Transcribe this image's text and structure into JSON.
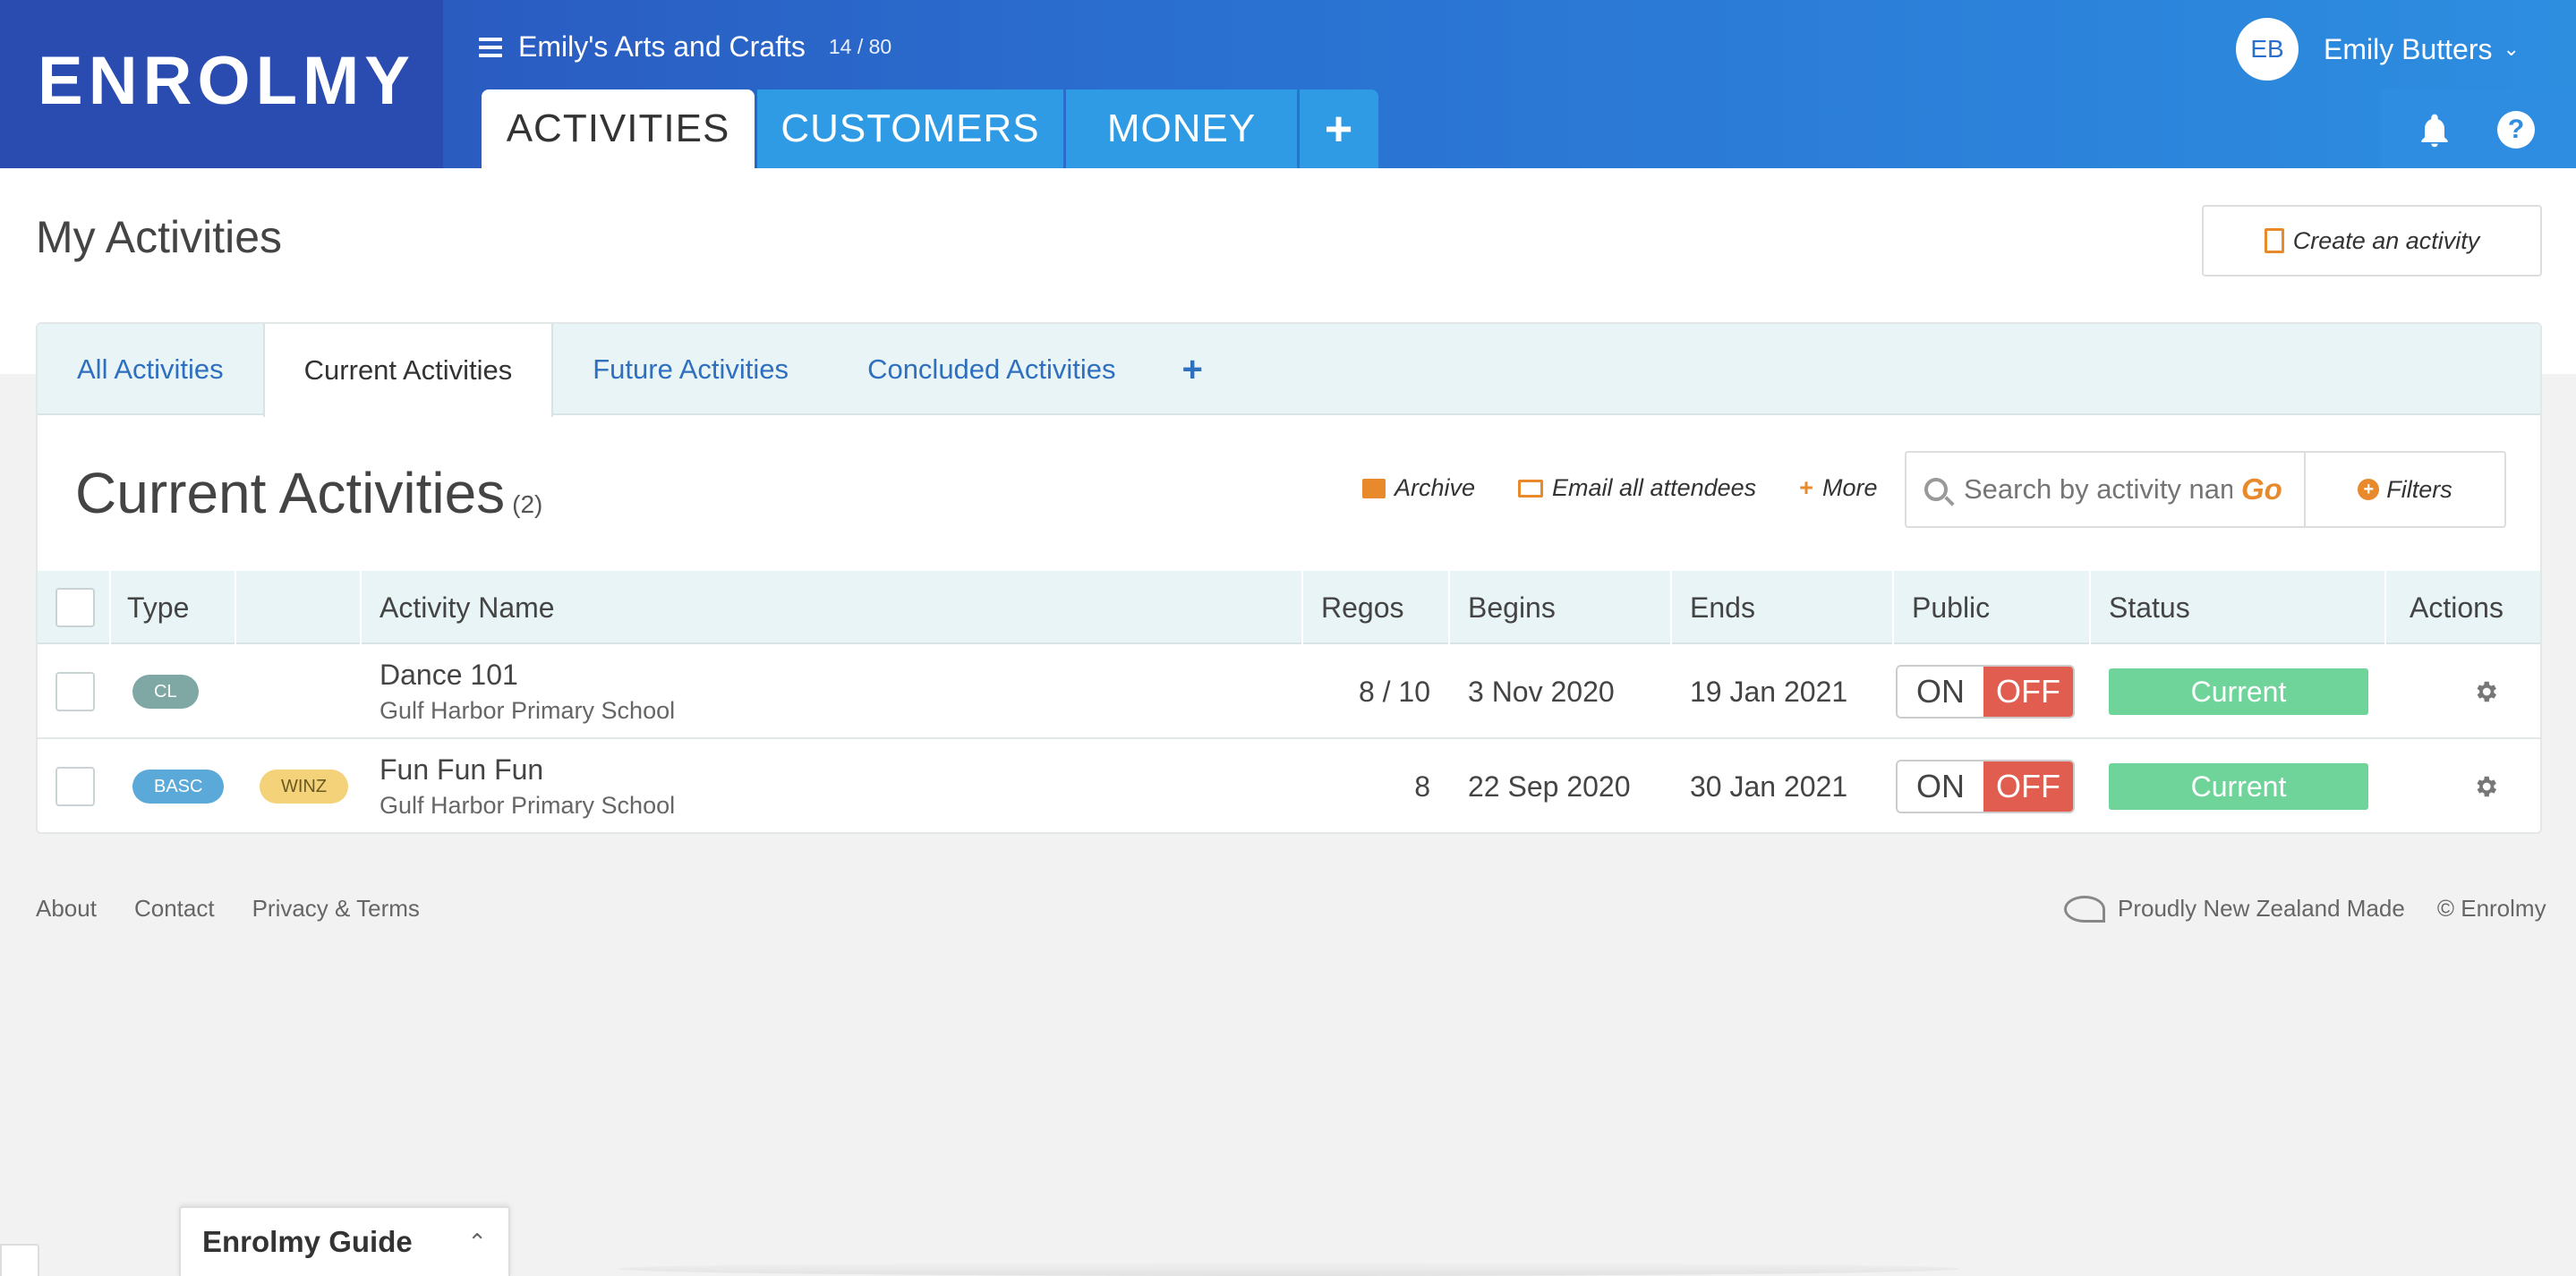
{
  "header": {
    "logo": "ENROLMY",
    "org_name": "Emily's Arts and Crafts",
    "org_count": "14 / 80",
    "nav_tabs": [
      {
        "label": "ACTIVITIES",
        "active": true
      },
      {
        "label": "CUSTOMERS",
        "active": false
      },
      {
        "label": "MONEY",
        "active": false
      }
    ],
    "nav_add": "+",
    "user_initials": "EB",
    "user_name": "Emily Butters",
    "help_glyph": "?"
  },
  "page": {
    "title": "My Activities",
    "create_button": "Create an activity"
  },
  "subtabs": [
    {
      "label": "All Activities",
      "active": false
    },
    {
      "label": "Current Activities",
      "active": true
    },
    {
      "label": "Future Activities",
      "active": false
    },
    {
      "label": "Concluded Activities",
      "active": false
    }
  ],
  "subtab_add": "+",
  "section": {
    "title": "Current Activities",
    "count": "(2)"
  },
  "toolbar": {
    "archive": "Archive",
    "email": "Email all attendees",
    "more": "More",
    "search_placeholder": "Search by activity name",
    "go": "Go",
    "filters": "Filters"
  },
  "table": {
    "headers": {
      "type": "Type",
      "name": "Activity Name",
      "regos": "Regos",
      "begins": "Begins",
      "ends": "Ends",
      "public": "Public",
      "status": "Status",
      "actions": "Actions"
    },
    "rows": [
      {
        "type": "CL",
        "tag": "",
        "name": "Dance 101",
        "location": "Gulf Harbor Primary School",
        "regos": "8 / 10",
        "begins": "3 Nov 2020",
        "ends": "19 Jan 2021",
        "public_on": "ON",
        "public_off": "OFF",
        "status": "Current"
      },
      {
        "type": "BASC",
        "tag": "WINZ",
        "name": "Fun Fun Fun",
        "location": "Gulf Harbor Primary School",
        "regos": "8",
        "begins": "22 Sep 2020",
        "ends": "30 Jan 2021",
        "public_on": "ON",
        "public_off": "OFF",
        "status": "Current"
      }
    ]
  },
  "footer": {
    "links": [
      "About",
      "Contact",
      "Privacy & Terms"
    ],
    "nz_made": "Proudly New Zealand Made",
    "copyright": "© Enrolmy"
  },
  "guide": {
    "title": "Enrolmy Guide"
  },
  "colors": {
    "accent_orange": "#e8892b",
    "link_blue": "#2f6fc0",
    "status_green": "#6fd49a",
    "toggle_off_red": "#e05d4f"
  }
}
